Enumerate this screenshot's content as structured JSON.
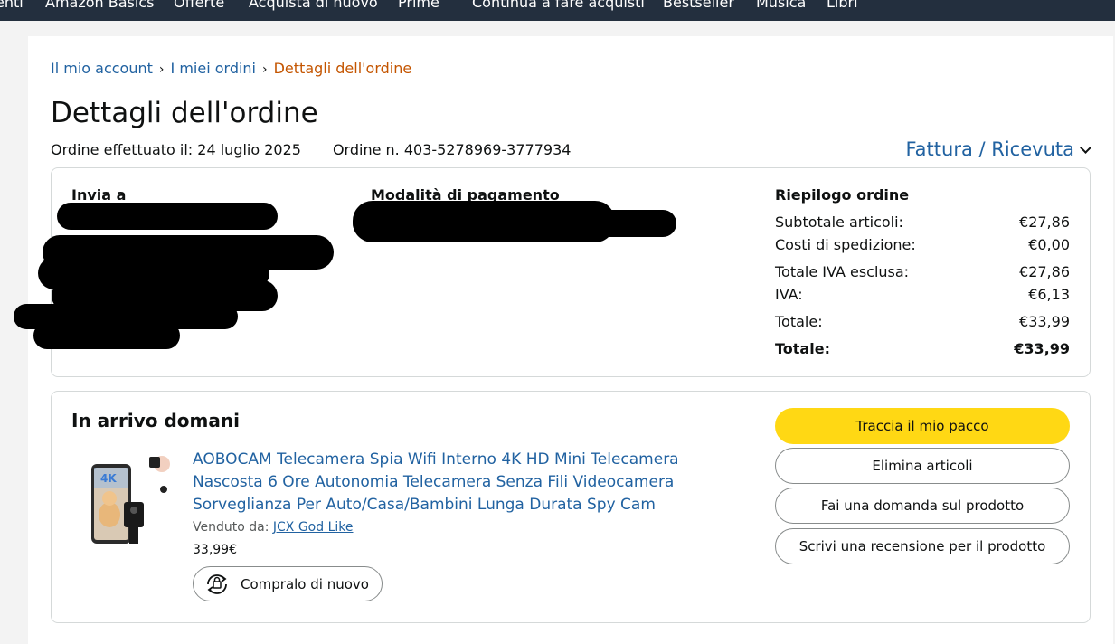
{
  "topnav": {
    "items": [
      "enti",
      "Amazon Basics",
      "Offerte",
      "Acquista di nuovo",
      "Prime",
      "Continua a fare acquisti",
      "Bestseller",
      "Musica",
      "Libri"
    ]
  },
  "breadcrumb": {
    "account": "Il mio account",
    "orders": "I miei ordini",
    "current": "Dettagli dell'ordine",
    "separator": "›"
  },
  "page_title": "Dettagli dell'ordine",
  "order_meta": {
    "placed": "Ordine effettuato il: 24 luglio 2025",
    "number": "Ordine n. 403-5278969-3777934"
  },
  "invoice_link": "Fattura / Ricevuta",
  "ship_to": {
    "heading": "Invia a"
  },
  "payment": {
    "heading": "Modalità di pagamento"
  },
  "summary": {
    "heading": "Riepilogo ordine",
    "rows": [
      {
        "label": "Subtotale articoli:",
        "value": "€27,86"
      },
      {
        "label": "Costi di spedizione:",
        "value": "€0,00"
      },
      {
        "label": "Totale IVA esclusa:",
        "value": "€27,86"
      },
      {
        "label": "IVA:",
        "value": "€6,13"
      },
      {
        "label": "Totale:",
        "value": "€33,99"
      }
    ],
    "grand_total": {
      "label": "Totale:",
      "value": "€33,99"
    }
  },
  "shipment": {
    "status": "In arrivo domani",
    "product": {
      "title": "AOBOCAM Telecamera Spia Wifi Interno 4K HD Mini Telecamera Nascosta 6 Ore Autonomia Telecamera Senza Fili Videocamera Sorveglianza Per Auto/Casa/Bambini Lunga Durata Spy Cam",
      "sold_by_label": "Venduto da:",
      "seller": "JCX God Like",
      "price": "33,99€",
      "thumb_badge": "4K"
    },
    "buy_again": "Compralo di nuovo",
    "actions": {
      "track": "Traccia il mio pacco",
      "remove": "Elimina articoli",
      "question": "Fai una domanda sul prodotto",
      "review": "Scrivi una recensione per il prodotto"
    }
  },
  "colors": {
    "link": "#2162a1",
    "breadcrumb_current": "#c45500",
    "primary_button": "#ffd814",
    "nav_bg": "#232f3e"
  }
}
